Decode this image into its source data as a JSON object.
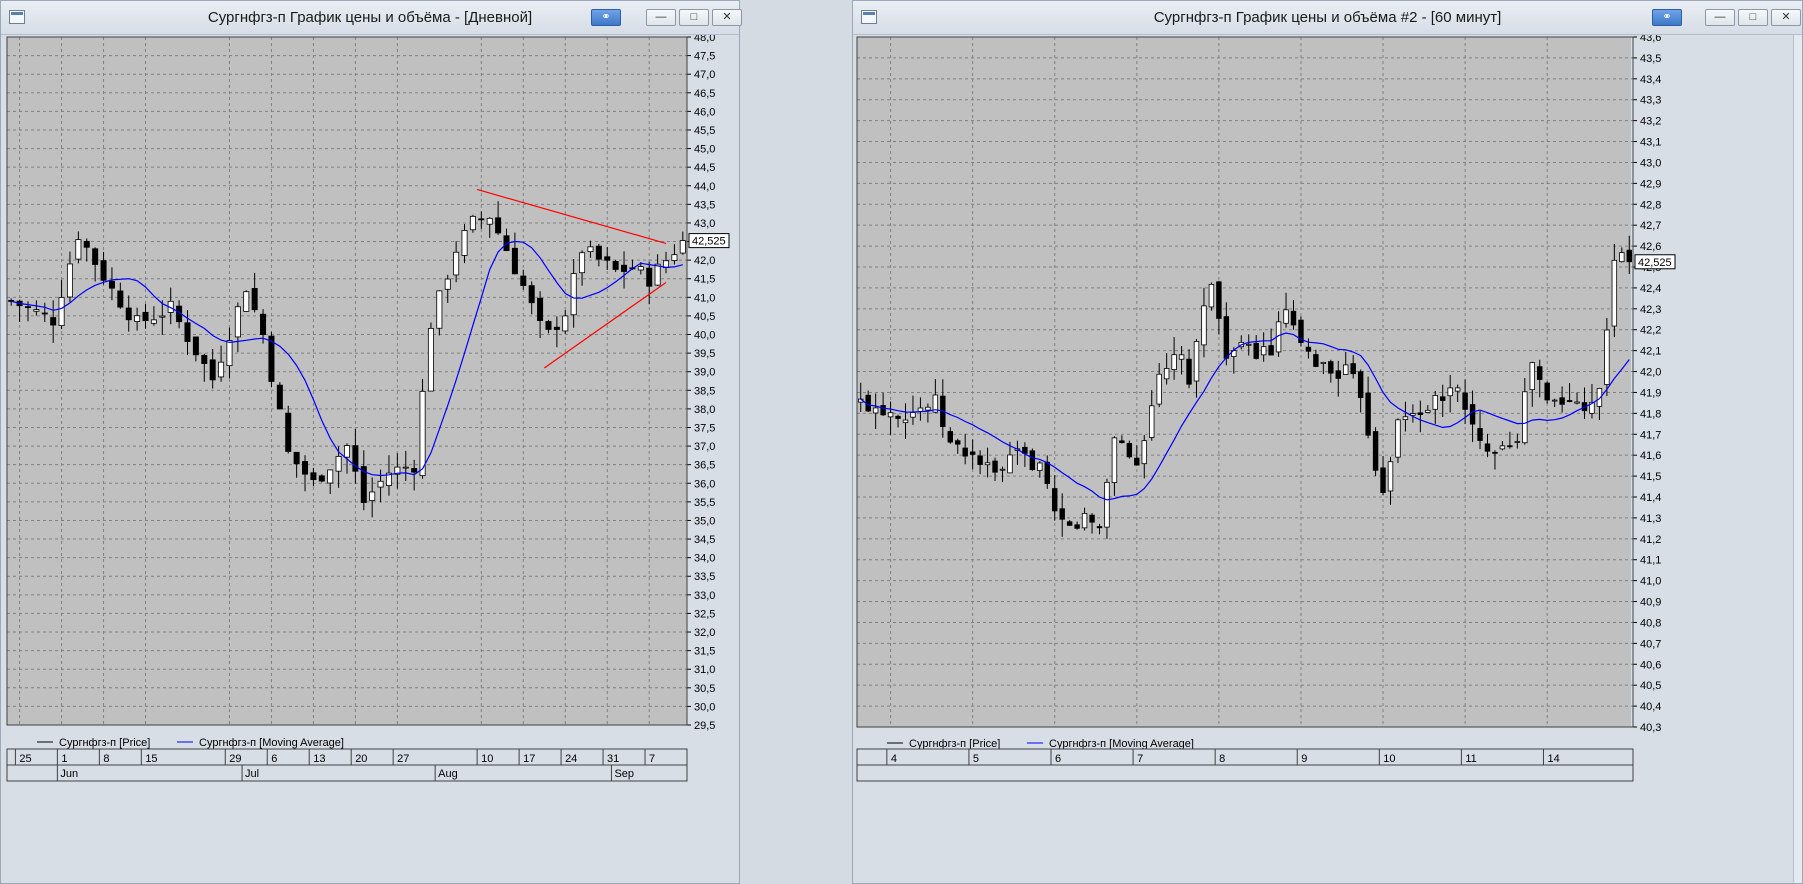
{
  "windows": [
    {
      "title": "Сургнфгз-п График цены и объёма - [Дневной]",
      "legend": [
        "Сургнфгз-п [Price]",
        "Сургнфгз-п [Moving Average]"
      ],
      "price_label": "42,525"
    },
    {
      "title": "Сургнфгз-п График цены и объёма #2 - [60 минут]",
      "legend": [
        "Сургнфгз-п [Price]",
        "Сургнфгз-п [Moving Average]"
      ],
      "price_label": "42,525"
    }
  ],
  "colors": {
    "plot_bg": "#c0c0c0",
    "up_candle": "#ffffff",
    "down_candle": "#000000",
    "ma_line": "#0000ff",
    "trendline": "#ff0000",
    "grid": "#808080"
  },
  "chart_data": [
    {
      "type": "candlestick",
      "interval": "Дневной",
      "ylim": [
        29.5,
        48.0
      ],
      "y_ticks": [
        "29,5",
        "30,0",
        "30,5",
        "31,0",
        "31,5",
        "32,0",
        "32,5",
        "33,0",
        "33,5",
        "34,0",
        "34,5",
        "35,0",
        "35,5",
        "36,0",
        "36,5",
        "37,0",
        "37,5",
        "38,0",
        "38,5",
        "39,0",
        "39,5",
        "40,0",
        "40,5",
        "41,0",
        "41,5",
        "42,0",
        "42,5",
        "43,0",
        "43,5",
        "44,0",
        "44,5",
        "45,0",
        "45,5",
        "46,0",
        "46,5",
        "47,0",
        "47,5",
        "48,0"
      ],
      "x_ticks": [
        {
          "label": "25",
          "index": 1
        },
        {
          "label": "1",
          "index": 6
        },
        {
          "label": "8",
          "index": 11
        },
        {
          "label": "15",
          "index": 16
        },
        {
          "label": "29",
          "index": 26
        },
        {
          "label": "6",
          "index": 31
        },
        {
          "label": "13",
          "index": 36
        },
        {
          "label": "20",
          "index": 41
        },
        {
          "label": "27",
          "index": 46
        },
        {
          "label": "10",
          "index": 56
        },
        {
          "label": "17",
          "index": 61
        },
        {
          "label": "24",
          "index": 66
        },
        {
          "label": "31",
          "index": 71
        },
        {
          "label": "7",
          "index": 76
        }
      ],
      "month_labels": [
        {
          "label": "Jun",
          "index": 6
        },
        {
          "label": "Jul",
          "index": 28
        },
        {
          "label": "Aug",
          "index": 51
        },
        {
          "label": "Sep",
          "index": 72
        }
      ],
      "bar_count": 81,
      "last_price": 42.525,
      "key_points": [
        [
          0,
          40.9
        ],
        [
          5,
          40.4
        ],
        [
          8,
          42.7
        ],
        [
          12,
          41.2
        ],
        [
          15,
          40.3
        ],
        [
          19,
          40.7
        ],
        [
          24,
          38.8
        ],
        [
          28,
          41.3
        ],
        [
          30,
          40.0
        ],
        [
          33,
          36.8
        ],
        [
          36,
          36.0
        ],
        [
          40,
          37.0
        ],
        [
          42,
          35.5
        ],
        [
          45,
          36.3
        ],
        [
          48,
          36.5
        ],
        [
          50,
          40.3
        ],
        [
          53,
          42.3
        ],
        [
          55,
          43.0
        ],
        [
          57,
          43.2
        ],
        [
          59,
          42.3
        ],
        [
          61,
          41.3
        ],
        [
          63,
          40.2
        ],
        [
          64,
          40.0
        ],
        [
          66,
          40.6
        ],
        [
          68,
          42.3
        ],
        [
          70,
          42.0
        ],
        [
          72,
          41.7
        ],
        [
          74,
          41.8
        ],
        [
          76,
          41.5
        ],
        [
          78,
          42.0
        ],
        [
          80,
          42.525
        ]
      ],
      "trendlines": [
        {
          "from": [
            55.5,
            43.9
          ],
          "to": [
            78,
            42.45
          ]
        },
        {
          "from": [
            63.5,
            39.1
          ],
          "to": [
            78,
            41.4
          ]
        }
      ]
    },
    {
      "type": "candlestick",
      "interval": "60 минут",
      "ylim": [
        40.3,
        43.6
      ],
      "y_ticks": [
        "40,3",
        "40,4",
        "40,5",
        "40,6",
        "40,7",
        "40,8",
        "40,9",
        "41,0",
        "41,1",
        "41,2",
        "41,3",
        "41,4",
        "41,5",
        "41,6",
        "41,7",
        "41,8",
        "41,9",
        "42,0",
        "42,1",
        "42,2",
        "42,3",
        "42,4",
        "42,5",
        "42,6",
        "42,7",
        "42,8",
        "42,9",
        "43,0",
        "43,1",
        "43,2",
        "43,3",
        "43,4",
        "43,5",
        "43,6"
      ],
      "x_ticks": [
        {
          "label": "4",
          "index": 4
        },
        {
          "label": "5",
          "index": 15
        },
        {
          "label": "6",
          "index": 26
        },
        {
          "label": "7",
          "index": 37
        },
        {
          "label": "8",
          "index": 48
        },
        {
          "label": "9",
          "index": 59
        },
        {
          "label": "10",
          "index": 70
        },
        {
          "label": "11",
          "index": 81
        },
        {
          "label": "14",
          "index": 92
        }
      ],
      "bar_count": 104,
      "last_price": 42.525,
      "key_points": [
        [
          0,
          41.85
        ],
        [
          6,
          41.8
        ],
        [
          10,
          41.85
        ],
        [
          12,
          41.65
        ],
        [
          15,
          41.6
        ],
        [
          18,
          41.5
        ],
        [
          21,
          41.6
        ],
        [
          24,
          41.55
        ],
        [
          26,
          41.3
        ],
        [
          28,
          41.25
        ],
        [
          30,
          41.3
        ],
        [
          32,
          41.25
        ],
        [
          34,
          41.7
        ],
        [
          37,
          41.55
        ],
        [
          39,
          41.85
        ],
        [
          40,
          41.95
        ],
        [
          43,
          42.1
        ],
        [
          44,
          41.9
        ],
        [
          46,
          42.35
        ],
        [
          47,
          42.4
        ],
        [
          49,
          42.1
        ],
        [
          52,
          42.1
        ],
        [
          55,
          42.1
        ],
        [
          57,
          42.3
        ],
        [
          59,
          42.1
        ],
        [
          61,
          42.05
        ],
        [
          63,
          42.0
        ],
        [
          65,
          42.0
        ],
        [
          67,
          41.9
        ],
        [
          69,
          41.55
        ],
        [
          70,
          41.45
        ],
        [
          72,
          41.75
        ],
        [
          74,
          41.8
        ],
        [
          77,
          41.85
        ],
        [
          79,
          41.9
        ],
        [
          80,
          41.95
        ],
        [
          81,
          41.8
        ],
        [
          83,
          41.65
        ],
        [
          86,
          41.65
        ],
        [
          88,
          41.7
        ],
        [
          90,
          42.05
        ],
        [
          92,
          41.85
        ],
        [
          95,
          41.85
        ],
        [
          97,
          41.85
        ],
        [
          99,
          41.9
        ],
        [
          101,
          42.55
        ],
        [
          103,
          42.525
        ]
      ]
    }
  ]
}
